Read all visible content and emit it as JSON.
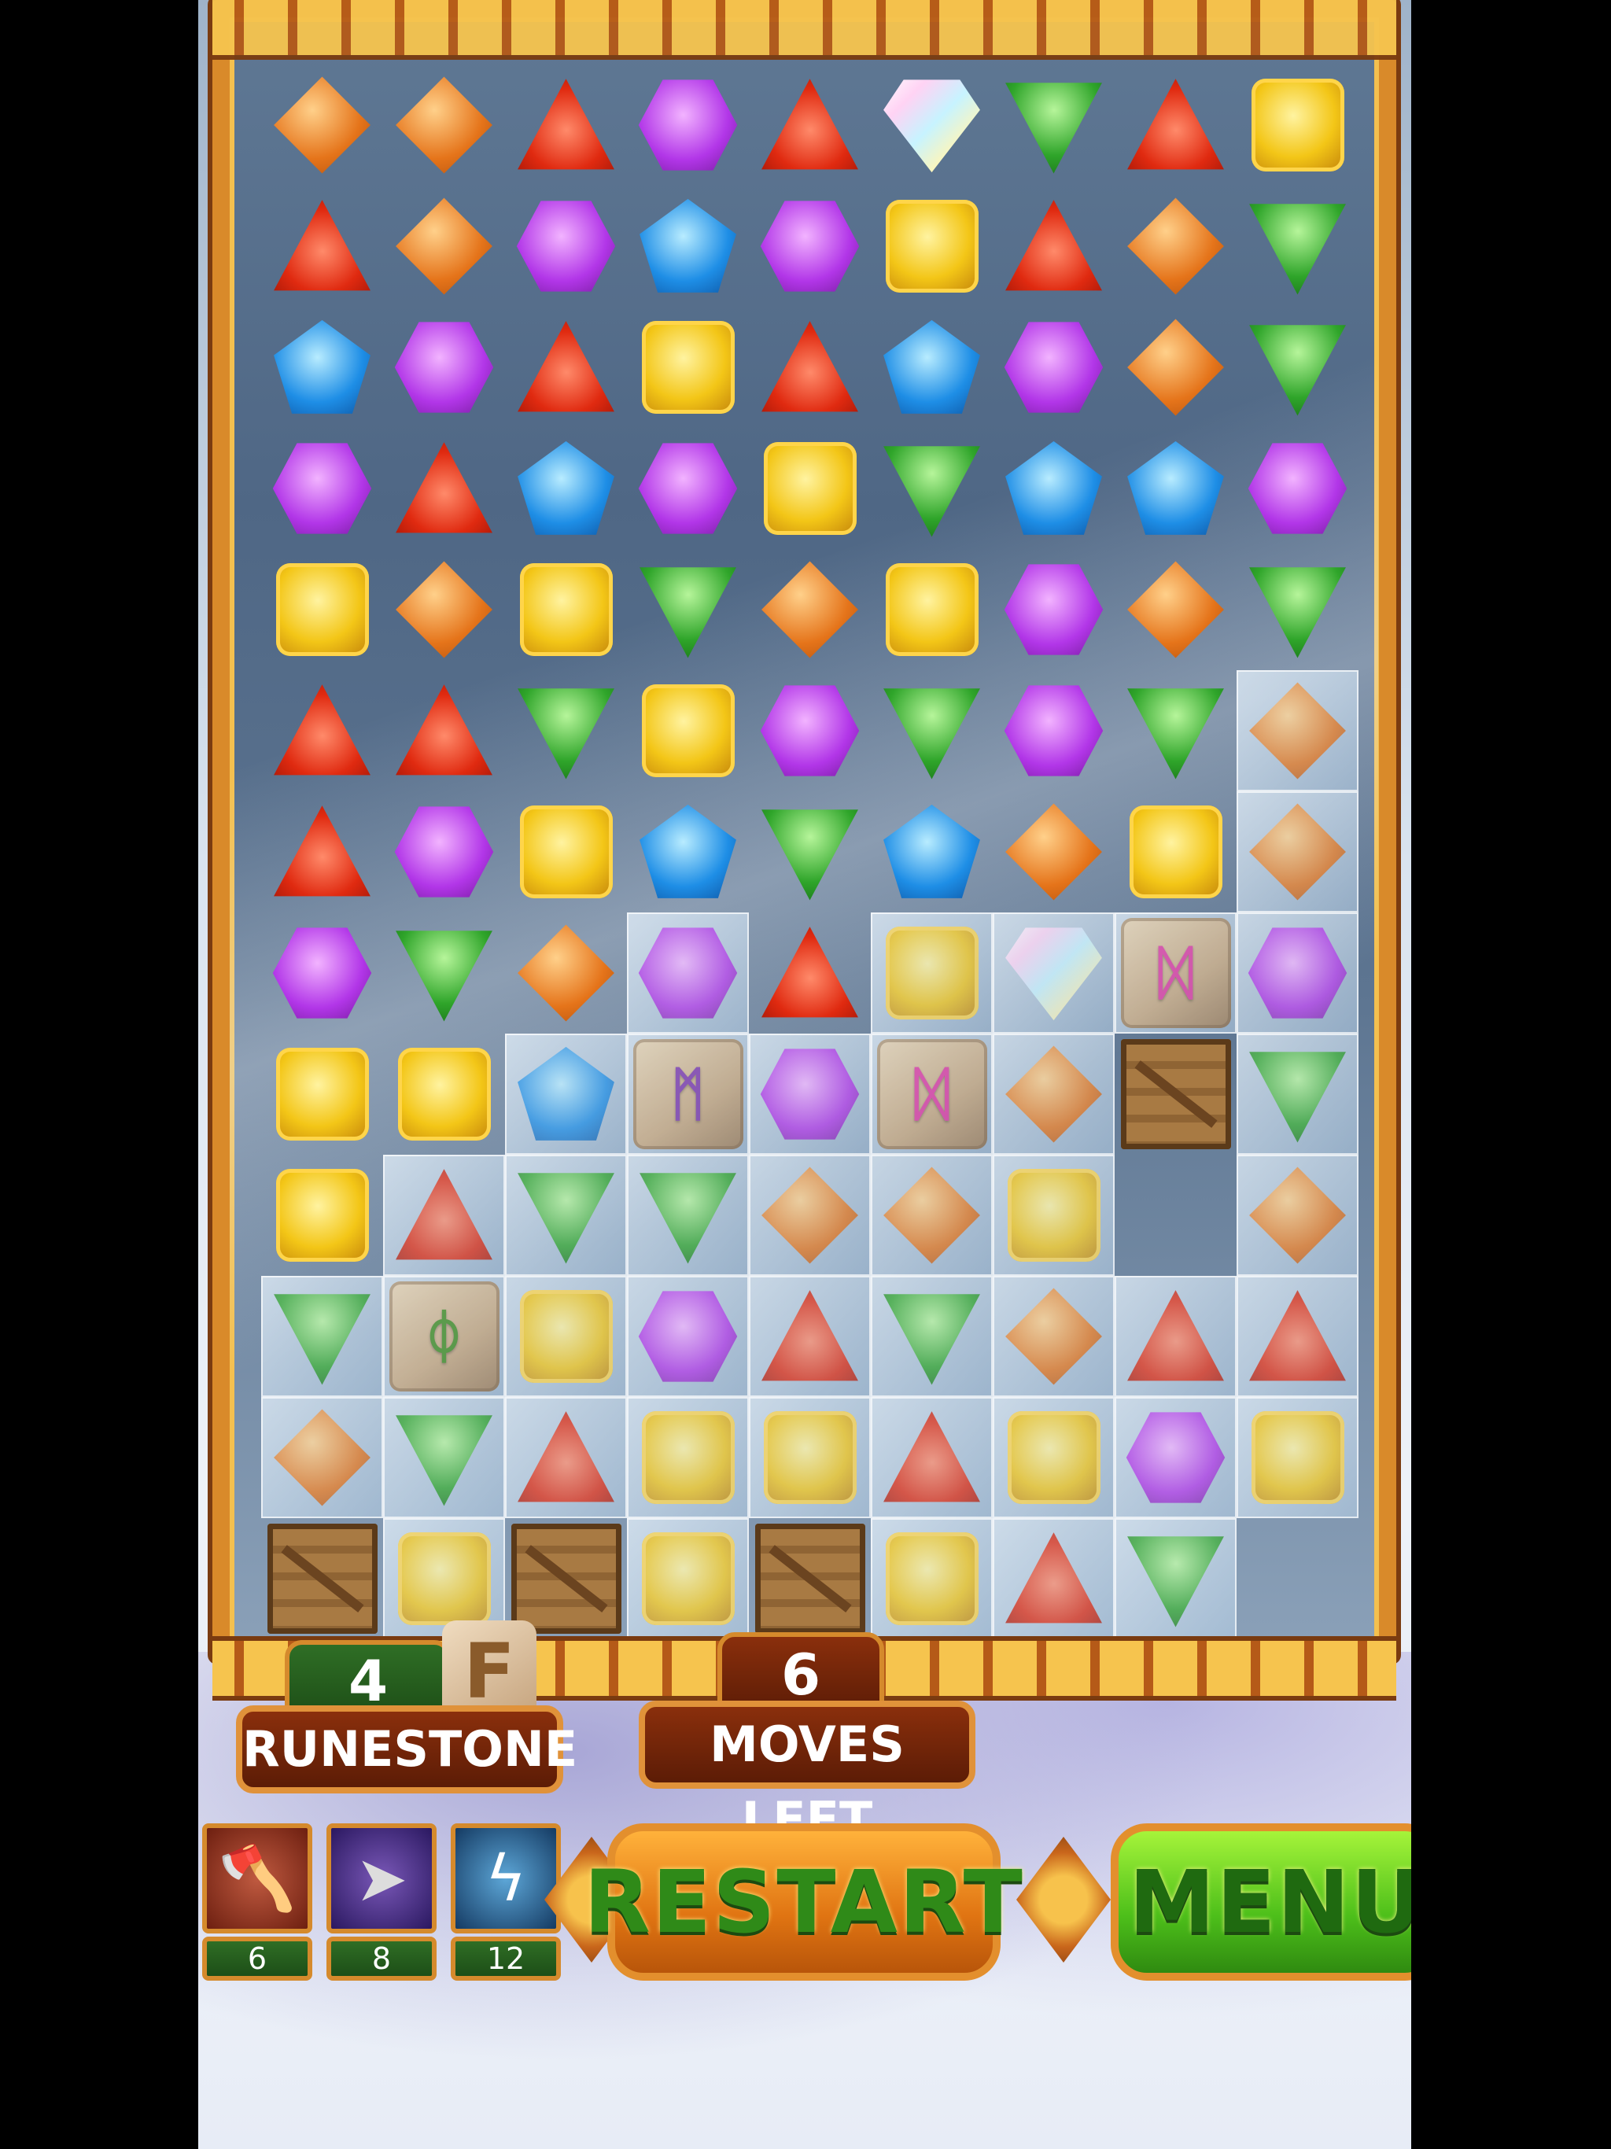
{
  "board": {
    "rows": [
      [
        "orange",
        "orange",
        "red",
        "purple",
        "red",
        "diamond",
        "green",
        "red",
        "yellow"
      ],
      [
        "red",
        "orange",
        "purple",
        "blue",
        "purple",
        "yellow",
        "red",
        "orange",
        "green"
      ],
      [
        "blue",
        "purple",
        "red",
        "yellow",
        "red",
        "blue",
        "purple",
        "orange",
        "green"
      ],
      [
        "purple",
        "red",
        "blue",
        "purple",
        "yellow",
        "green",
        "blue",
        "blue",
        "purple"
      ],
      [
        "yellow",
        "orange",
        "yellow",
        "green",
        "orange",
        "yellow",
        "purple",
        "orange",
        "green"
      ],
      [
        "red",
        "red",
        "green",
        "yellow",
        "purple",
        "green",
        "purple",
        "green",
        "orange*"
      ],
      [
        "red",
        "purple",
        "yellow",
        "blue",
        "green",
        "blue",
        "orange",
        "yellow",
        "orange*"
      ],
      [
        "purple",
        "green",
        "orange",
        "purple*",
        "red",
        "yellow*",
        "diamond*",
        "stone-pink*",
        "purple*"
      ],
      [
        "yellow",
        "yellow",
        "blue*",
        "stone-purple*",
        "purple*",
        "stone-pink*",
        "orange*",
        "crate",
        "green*"
      ],
      [
        "yellow",
        "red*",
        "green*",
        "green*",
        "orange*",
        "orange*",
        "yellow*",
        "empty",
        "orange*"
      ],
      [
        "green*",
        "stone-green*",
        "yellow*",
        "purple*",
        "red*",
        "green*",
        "orange*",
        "red*",
        "red*"
      ],
      [
        "orange*",
        "green*",
        "red*",
        "yellow*",
        "yellow*",
        "red*",
        "yellow*",
        "purple*",
        "yellow*"
      ],
      [
        "crate",
        "yellow*",
        "crate",
        "yellow*",
        "crate",
        "yellow*",
        "red*",
        "green*",
        "empty"
      ]
    ],
    "legend_note": "* = frozen in ice"
  },
  "hud": {
    "runestone_count": "4",
    "runestone_label": "RUNESTONE",
    "runestone_rune": "F",
    "moves_count": "6",
    "moves_label": "MOVES LEFT"
  },
  "powerups": {
    "axe_count": "6",
    "arrow_count": "8",
    "lightning_count": "12"
  },
  "buttons": {
    "restart_label": "RESTART",
    "menu_label": "MENU"
  },
  "runes": {
    "purple": "ᛗ",
    "pink": "ᛞ",
    "green": "ᛰ"
  },
  "colors": {
    "frame": "#d98a2a",
    "plaque_green": "#2f6e25",
    "plaque_brown": "#8a2f0c"
  }
}
